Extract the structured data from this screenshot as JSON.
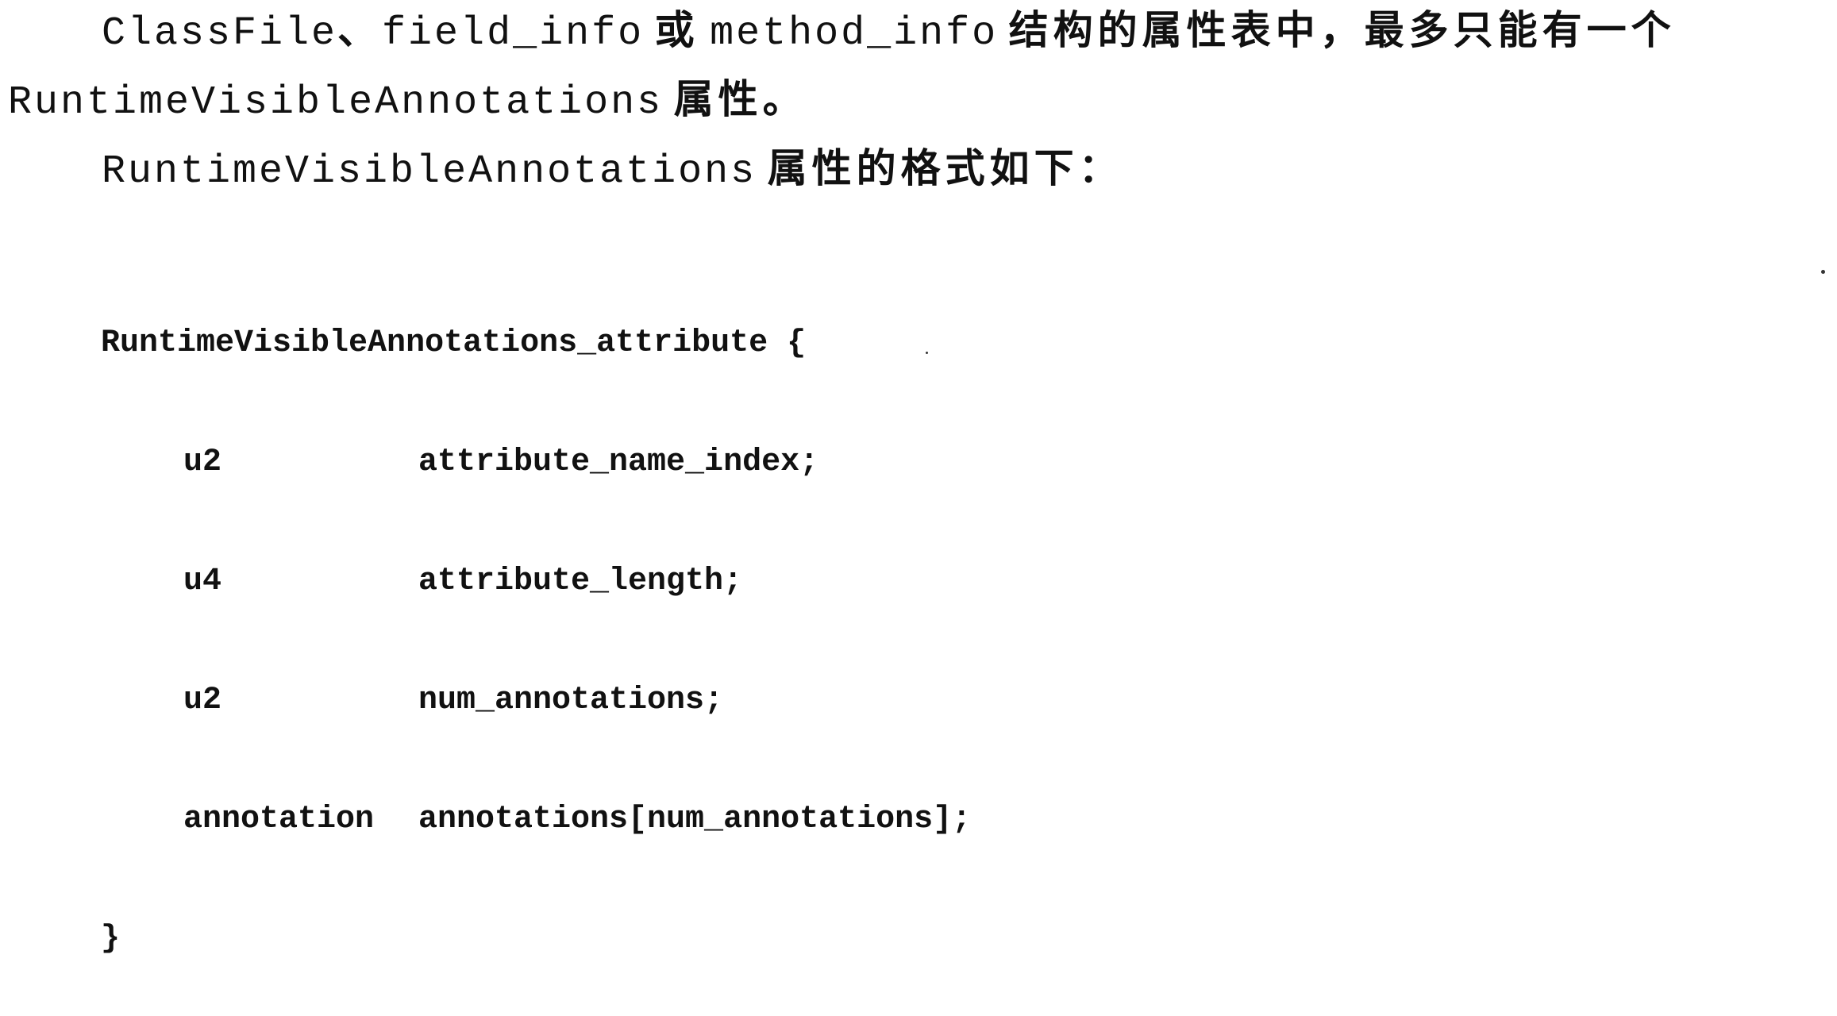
{
  "paragraph1": {
    "line1_code_a": "ClassFile",
    "line1_sep": "、",
    "line1_code_b": "field_info",
    "line1_or": "或",
    "line1_code_c": "method_info",
    "line1_text": "结构的属性表中，最多只能有一个",
    "line2_code": "RuntimeVisibleAnnotations",
    "line2_text": "属性。"
  },
  "paragraph2": {
    "code": "RuntimeVisibleAnnotations",
    "text": "属性的格式如下："
  },
  "code_block": {
    "header": "RuntimeVisibleAnnotations_attribute {",
    "fields": [
      {
        "type": "u2",
        "name": "attribute_name_index;"
      },
      {
        "type": "u4",
        "name": "attribute_length;"
      },
      {
        "type": "u2",
        "name": "num_annotations;"
      },
      {
        "type": "annotation",
        "name": "annotations[num_annotations];"
      }
    ],
    "footer": "}"
  }
}
